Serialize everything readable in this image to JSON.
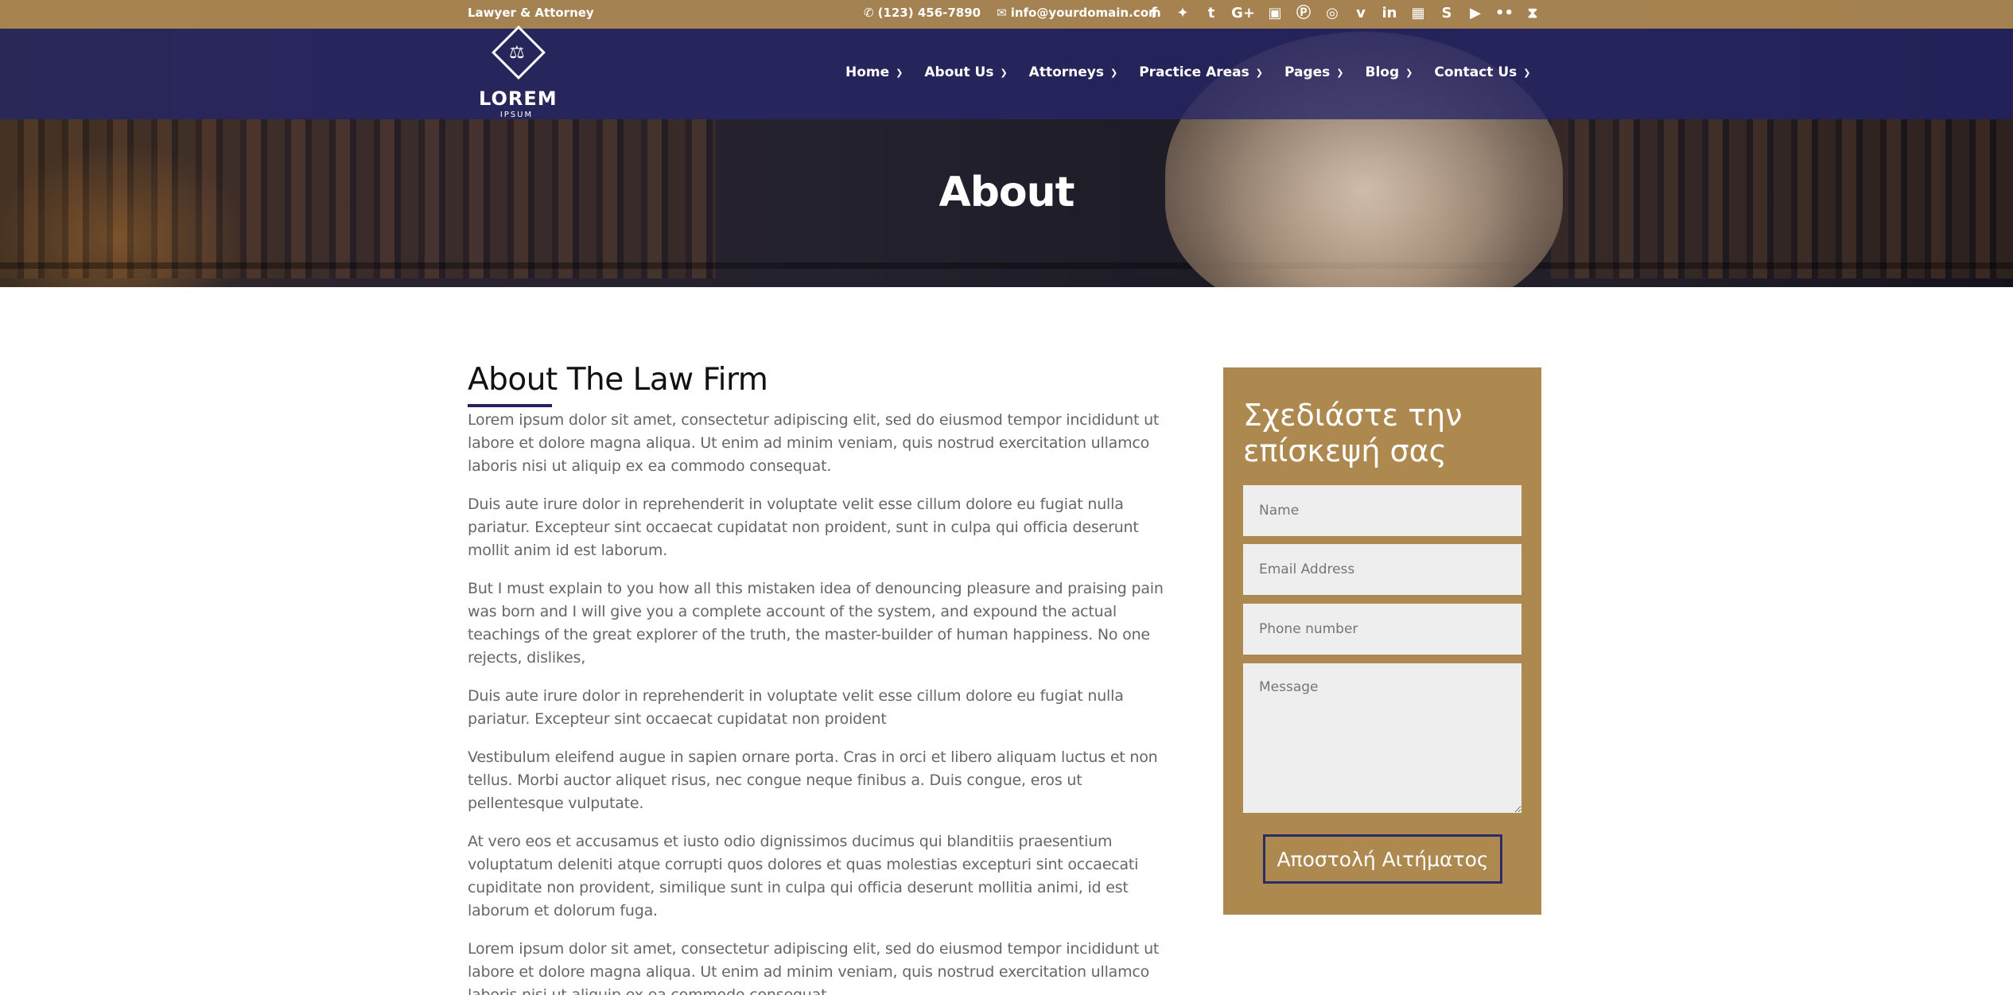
{
  "topbar": {
    "tagline": "Lawyer & Attorney",
    "phone": "(123) 456-7890",
    "email": "info@yourdomain.com",
    "socials": [
      "facebook-icon",
      "twitter-icon",
      "tumblr-icon",
      "google-plus-icon",
      "instagram-icon",
      "pinterest-icon",
      "dribbble-icon",
      "vimeo-icon",
      "linkedin-icon",
      "flickr-icon",
      "skype-icon",
      "youtube-icon",
      "flickr-dots-icon",
      "rss-icon"
    ]
  },
  "logo": {
    "word": "LOREM",
    "sub": "IPSUM"
  },
  "nav": {
    "items": [
      "Home",
      "About Us",
      "Attorneys",
      "Practice Areas",
      "Pages",
      "Blog",
      "Contact Us"
    ]
  },
  "hero": {
    "title": "About"
  },
  "main": {
    "heading": "About The Law Firm",
    "paragraphs": [
      "Lorem ipsum dolor sit amet, consectetur adipiscing elit, sed do eiusmod tempor incididunt ut labore et dolore magna aliqua. Ut enim ad minim veniam, quis nostrud exercitation ullamco laboris nisi ut aliquip ex ea commodo consequat.",
      "Duis aute irure dolor in reprehenderit in voluptate velit esse cillum dolore eu fugiat nulla pariatur. Excepteur sint occaecat cupidatat non proident, sunt in culpa qui officia deserunt mollit anim id est laborum.",
      "But I must explain to you how all this mistaken idea of denouncing pleasure and praising pain was born and I will give you a complete account of the system, and expound the actual teachings of the great explorer of the truth, the master-builder of human happiness. No one rejects, dislikes,",
      "Duis aute irure dolor in reprehenderit in voluptate velit esse cillum dolore eu fugiat nulla pariatur. Excepteur sint occaecat cupidatat non proident",
      "Vestibulum eleifend augue in sapien ornare porta. Cras in orci et libero aliquam luctus et non tellus. Morbi auctor aliquet risus, nec congue neque finibus a. Duis congue, eros ut pellentesque vulputate.",
      "At vero eos et accusamus et iusto odio dignissimos ducimus qui blanditiis praesentium voluptatum deleniti atque corrupti quos dolores et quas molestias excepturi sint occaecati cupiditate non provident, similique sunt in culpa qui officia deserunt mollitia animi, id est laborum et dolorum fuga.",
      "Lorem ipsum dolor sit amet, consectetur adipiscing elit, sed do eiusmod tempor incididunt ut labore et dolore magna aliqua. Ut enim ad minim veniam, quis nostrud exercitation ullamco laboris nisi ut aliquip ex ea commodo consequat."
    ]
  },
  "form": {
    "title": "Σχεδιάστε την επίσκεψή σας",
    "name_placeholder": "Name",
    "email_placeholder": "Email Address",
    "phone_placeholder": "Phone number",
    "message_placeholder": "Message",
    "submit_label": "Αποστολή Αιτήματος"
  },
  "colors": {
    "gold": "#ad8950",
    "navy": "#24235f",
    "topbar": "#af8a54"
  }
}
